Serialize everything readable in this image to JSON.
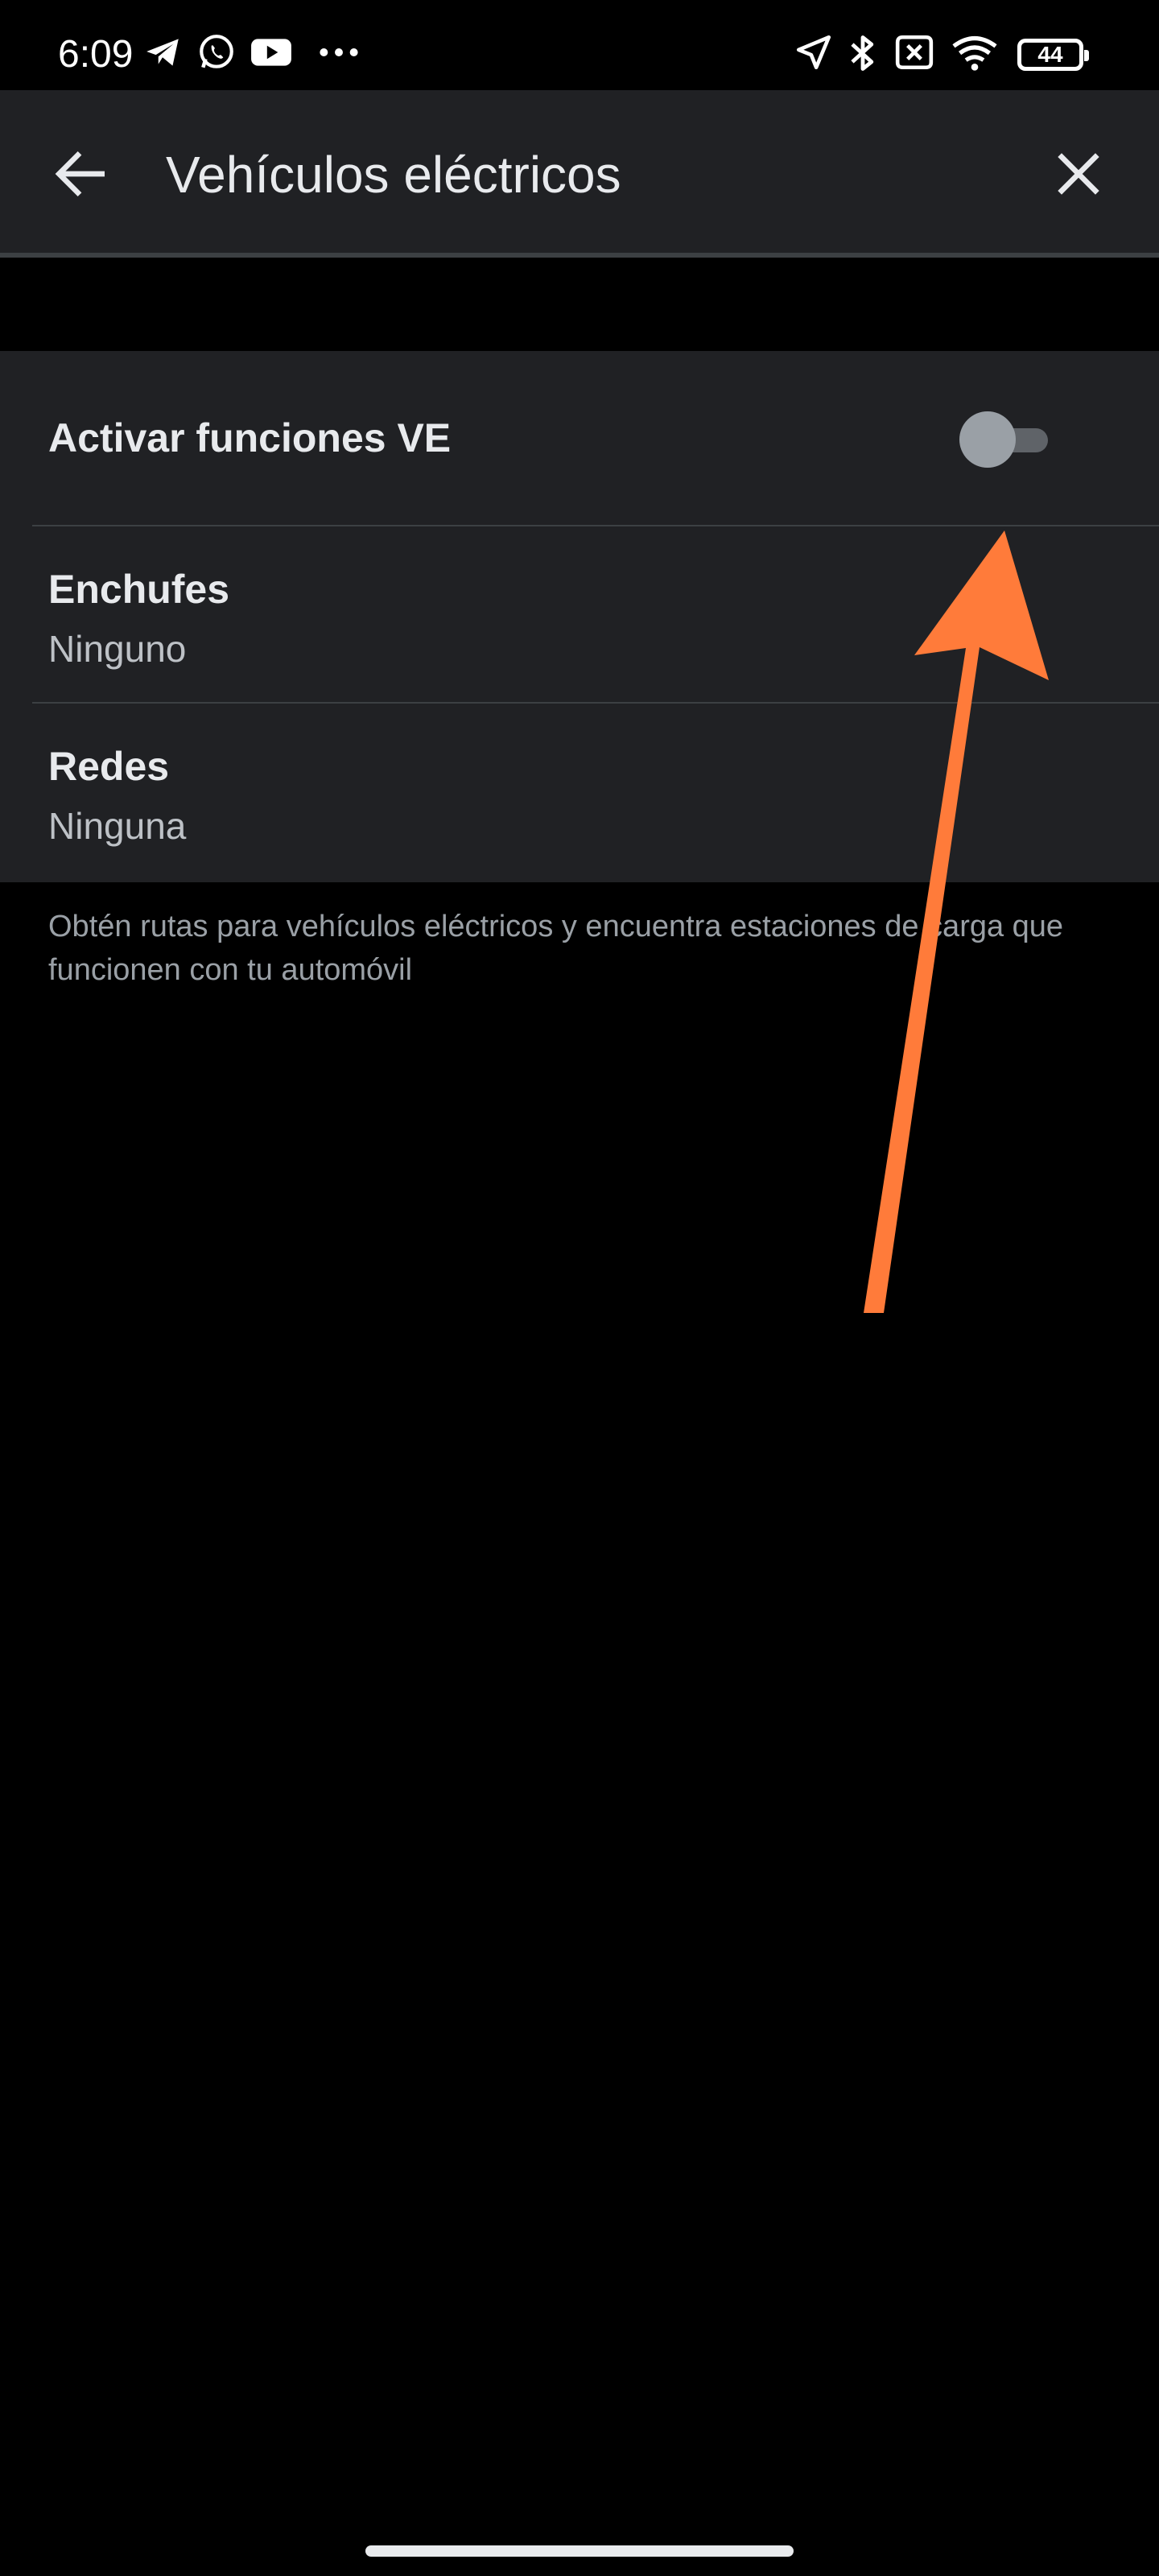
{
  "status_bar": {
    "time": "6:09",
    "battery_level": "44",
    "left_icons": [
      "telegram-icon",
      "whatsapp-icon",
      "youtube-icon",
      "more-notifications-icon"
    ],
    "right_icons": [
      "location-icon",
      "bluetooth-icon",
      "no-sim-icon",
      "wifi-icon",
      "battery-icon"
    ]
  },
  "app_bar": {
    "title": "Vehículos eléctricos",
    "back_icon": "arrow-back-icon",
    "close_icon": "close-icon"
  },
  "settings": {
    "ev_features": {
      "label": "Activar funciones VE",
      "enabled": false
    },
    "plugs": {
      "label": "Enchufes",
      "value": "Ninguno"
    },
    "networks": {
      "label": "Redes",
      "value": "Ninguna"
    }
  },
  "caption": "Obtén rutas para vehículos eléctricos y encuentra estaciones de carga que funcionen con tu automóvil",
  "colors": {
    "background": "#000000",
    "surface": "#202124",
    "annotation_arrow": "#ff7b3a",
    "toggle_off_thumb": "#9aa0a6"
  }
}
